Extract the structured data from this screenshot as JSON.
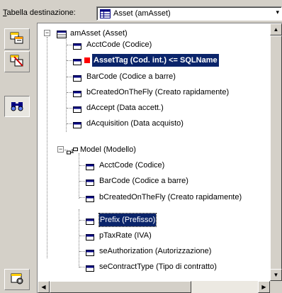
{
  "header": {
    "label_first": "T",
    "label_rest": "abella destinazione:",
    "combo_value": "Asset (amAsset)",
    "combo_icon": "table-icon"
  },
  "toolbar": {
    "buttons": [
      {
        "name": "add-field-button",
        "icon": "table-add-icon"
      },
      {
        "name": "remove-field-button",
        "icon": "table-remove-icon"
      },
      {
        "name": "find-button",
        "icon": "binoculars-icon"
      },
      {
        "name": "options-button",
        "icon": "settings-icon"
      }
    ]
  },
  "tree": {
    "root": "amAsset (Asset)",
    "items": [
      "AcctCode (Codice)",
      "AssetTag (Cod. int.)  <=  SQLName",
      "BarCode (Codice a barre)",
      "bCreatedOnTheFly (Creato rapidamente)",
      "dAccept (Data accett.)",
      "dAcquisition (Data acquisto)"
    ],
    "group": "Model (Modello)",
    "group_items": [
      "AcctCode (Codice)",
      "BarCode (Codice a barre)",
      "bCreatedOnTheFly (Creato rapidamente)"
    ],
    "lower_items": [
      "Prefix (Prefisso)",
      "pTaxRate (IVA)",
      "seAuthorization (Autorizzazione)",
      "seContractType (Tipo di contratto)"
    ]
  },
  "colors": {
    "selection": "#0a246a",
    "mapped_marker": "#ff0000",
    "window_bg": "#d4d0c8"
  }
}
